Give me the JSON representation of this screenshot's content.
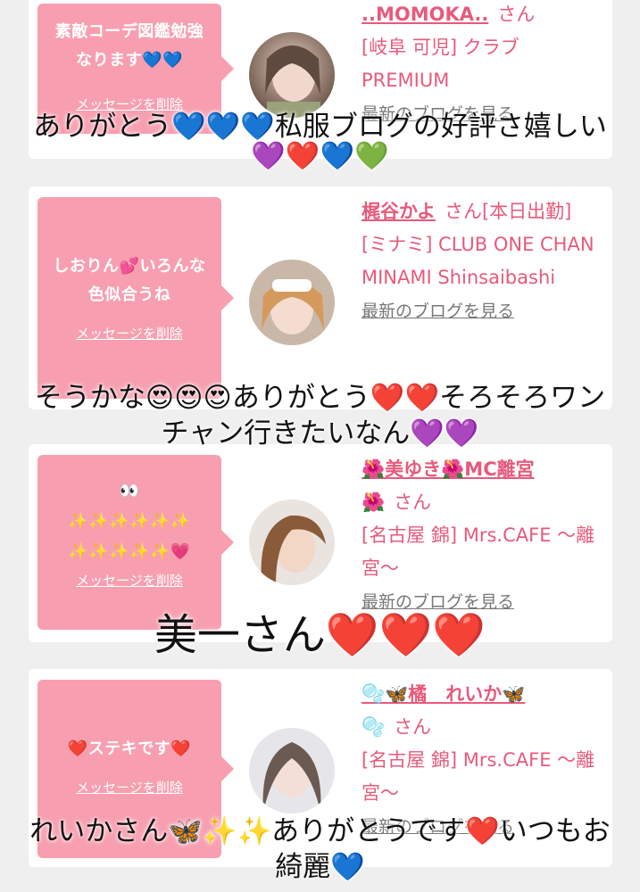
{
  "cards": [
    {
      "message": "素敵コーデ図鑑勉強なります💙💙",
      "delete_label": "メッセージを削除",
      "name": "..MOMOKA..",
      "san": "さん",
      "shop": "[岐阜 可児] クラブ PREMIUM",
      "blog_link": "最新のブログを見る",
      "overlay_caption": "ありがとう💙💙💙私服ブログの好評さ嬉しい",
      "overlay_caption2": "💜❤️💙💚"
    },
    {
      "message": "しおりん💕いろんな色似合うね",
      "delete_label": "メッセージを削除",
      "name": "梶谷かよ",
      "san": "さん[本日出勤]",
      "shop": "[ミナミ] CLUB ONE CHAN MINAMI Shinsaibashi",
      "blog_link": "最新のブログを見る",
      "overlay_caption": "そうかな😍😍😍ありがとう❤️❤️そろそろワン",
      "overlay_caption2": "チャン行きたいなん💜💜"
    },
    {
      "message": "👀✨✨✨✨✨✨✨✨✨✨✨💗",
      "message_line1": "👀",
      "message_line2": "✨✨✨✨✨✨",
      "message_line3": "✨✨✨✨✨💗",
      "delete_label": "メッセージを削除",
      "name": "🌺美ゆき🌺MC離宮🌺",
      "name_line1": "🌺美ゆき🌺MC離宮",
      "name_line2": "🌺",
      "san": "さん",
      "shop": "[名古屋 錦] Mrs.CAFE 〜離宮〜",
      "blog_link": "最新のブログを見る",
      "overlay_caption": "美一さん❤️❤️❤️"
    },
    {
      "message": "❤️ステキです❤️",
      "delete_label": "メッセージを削除",
      "name": "🫧🦋橘　れいか🦋🫧",
      "name_line1": "🫧🦋橘　れいか🦋",
      "name_line2": "🫧",
      "san": "さん",
      "shop": "[名古屋 錦] Mrs.CAFE 〜離宮〜",
      "blog_link": "最新のブログを見る",
      "overlay_caption": "れいかさん🦋✨✨ありがとうです❤️いつもお",
      "overlay_caption2": "綺麗💙"
    }
  ],
  "colors": {
    "accent": "#e75a7b",
    "bubble": "#f79fb0",
    "background": "#efefef"
  },
  "icons": [
    "avatar-photo-1",
    "avatar-photo-2",
    "avatar-photo-3",
    "avatar-photo-4"
  ]
}
